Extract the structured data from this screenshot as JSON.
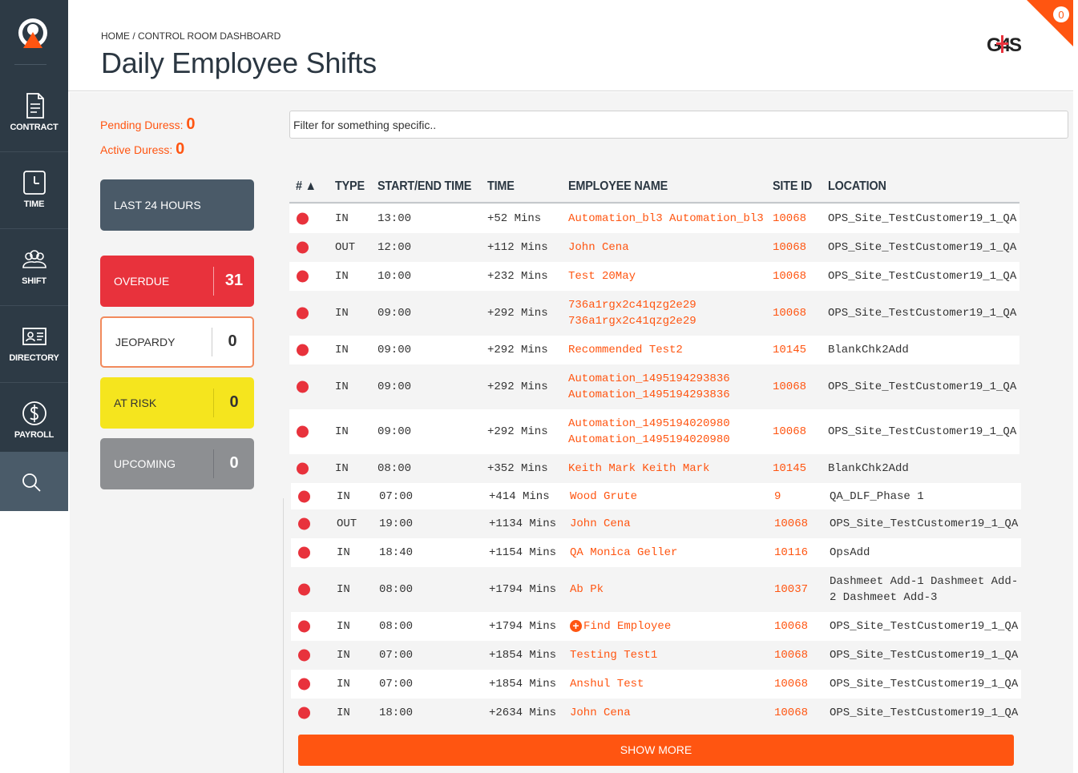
{
  "nav": {
    "items": [
      {
        "label": "CONTRACT",
        "icon": "contract-icon"
      },
      {
        "label": "TIME",
        "icon": "clock-icon"
      },
      {
        "label": "SHIFT",
        "icon": "people-icon"
      },
      {
        "label": "DIRECTORY",
        "icon": "id-card-icon"
      },
      {
        "label": "PAYROLL",
        "icon": "dollar-icon"
      }
    ],
    "search_icon": "search-icon"
  },
  "header": {
    "breadcrumb": "HOME / CONTROL ROOM DASHBOARD",
    "title": "Daily Employee Shifts",
    "brand": "G4S",
    "notification_count": "0"
  },
  "duress": {
    "pending_label": "Pending Duress:",
    "pending_value": "0",
    "active_label": "Active Duress:",
    "active_value": "0"
  },
  "tiles": {
    "last24": "LAST 24 HOURS",
    "overdue_label": "OVERDUE",
    "overdue_count": "31",
    "jeopardy_label": "JEOPARDY",
    "jeopardy_count": "0",
    "atrisk_label": "AT RISK",
    "atrisk_count": "0",
    "upcoming_label": "UPCOMING",
    "upcoming_count": "0"
  },
  "filter": {
    "placeholder": "Filter for something specific.."
  },
  "table": {
    "headers": [
      "# ▲",
      "TYPE",
      "START/END TIME",
      "TIME",
      "EMPLOYEE NAME",
      "SITE ID",
      "LOCATION"
    ],
    "rows": [
      {
        "type": "IN",
        "start": "13:00",
        "time": "+52 Mins",
        "name": "Automation_bl3 Automation_bl3",
        "site": "10068",
        "location": "OPS_Site_TestCustomer19_1_QA"
      },
      {
        "type": "OUT",
        "start": "12:00",
        "time": "+112 Mins",
        "name": "John Cena",
        "site": "10068",
        "location": "OPS_Site_TestCustomer19_1_QA"
      },
      {
        "type": "IN",
        "start": "10:00",
        "time": "+232 Mins",
        "name": "Test 20May",
        "site": "10068",
        "location": "OPS_Site_TestCustomer19_1_QA"
      },
      {
        "type": "IN",
        "start": "09:00",
        "time": "+292 Mins",
        "name": "736a1rgx2c41qzg2e29",
        "name2": "736a1rgx2c41qzg2e29",
        "site": "10068",
        "location": "OPS_Site_TestCustomer19_1_QA"
      },
      {
        "type": "IN",
        "start": "09:00",
        "time": "+292 Mins",
        "name": "Recommended Test2",
        "site": "10145",
        "location": "BlankChk2Add"
      },
      {
        "type": "IN",
        "start": "09:00",
        "time": "+292 Mins",
        "name": "Automation_1495194293836",
        "name2": "Automation_1495194293836",
        "site": "10068",
        "location": "OPS_Site_TestCustomer19_1_QA"
      },
      {
        "type": "IN",
        "start": "09:00",
        "time": "+292 Mins",
        "name": "Automation_1495194020980",
        "name2": "Automation_1495194020980",
        "site": "10068",
        "location": "OPS_Site_TestCustomer19_1_QA"
      },
      {
        "type": "IN",
        "start": "08:00",
        "time": "+352 Mins",
        "name": "Keith Mark Keith Mark",
        "site": "10145",
        "location": "BlankChk2Add"
      },
      {
        "type": "IN",
        "start": "07:00",
        "time": "+414 Mins",
        "name": "Wood Grute",
        "site": "9",
        "location": "QA_DLF_Phase 1"
      },
      {
        "type": "OUT",
        "start": "19:00",
        "time": "+1134 Mins",
        "name": "John Cena",
        "site": "10068",
        "location": "OPS_Site_TestCustomer19_1_QA"
      },
      {
        "type": "IN",
        "start": "18:40",
        "time": "+1154 Mins",
        "name": "QA Monica Geller",
        "site": "10116",
        "location": "OpsAdd"
      },
      {
        "type": "IN",
        "start": "08:00",
        "time": "+1794 Mins",
        "name": "Ab Pk",
        "site": "10037",
        "location": "Dashmeet Add-1 Dashmeet Add-",
        "location2": "2 Dashmeet Add-3"
      },
      {
        "type": "IN",
        "start": "08:00",
        "time": "+1794 Mins",
        "name": "Find Employee",
        "site": "10068",
        "location": "OPS_Site_TestCustomer19_1_QA"
      },
      {
        "type": "IN",
        "start": "07:00",
        "time": "+1854 Mins",
        "name": "Testing Test1",
        "site": "10068",
        "location": "OPS_Site_TestCustomer19_1_QA"
      },
      {
        "type": "IN",
        "start": "07:00",
        "time": "+1854 Mins",
        "name": "Anshul Test",
        "site": "10068",
        "location": "OPS_Site_TestCustomer19_1_QA"
      },
      {
        "type": "IN",
        "start": "18:00",
        "time": "+2634 Mins",
        "name": "John Cena",
        "site": "10068",
        "location": "OPS_Site_TestCustomer19_1_QA"
      }
    ]
  },
  "show_more": "SHOW MORE",
  "colors": {
    "accent": "#ff5511",
    "sidebar": "#2d3a45",
    "overdue": "#e8323c",
    "atrisk": "#f5e51e",
    "upcoming": "#8d8f92",
    "last24": "#4a5a68"
  }
}
